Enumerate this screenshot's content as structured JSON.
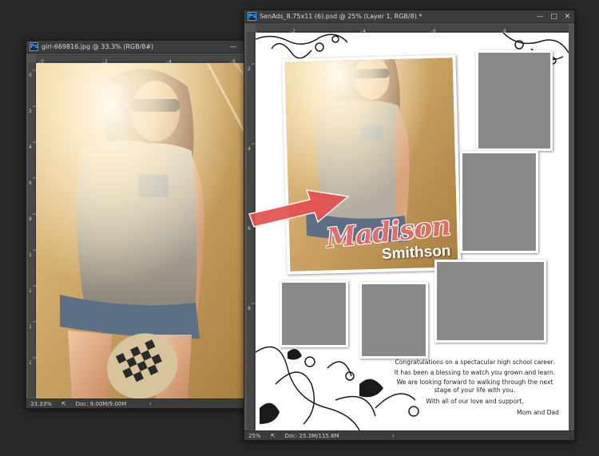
{
  "windows": {
    "photo": {
      "title": "girl-669816.jpg @ 33.3% (RGB/8#)",
      "zoom": "33.33%",
      "doc_info": "Doc: 9.00M/9.00M"
    },
    "layout": {
      "title": "SenAds_8.75x11 (6).psd @ 25% (Layer 1, RGB/8) *",
      "zoom": "25%",
      "doc_info": "Doc: 25.3M/115.8M"
    }
  },
  "app_logo": "Ps",
  "window_buttons": {
    "minimize": "—",
    "maximize": "□",
    "close": "✕"
  },
  "status_arrow": "›",
  "ruler": {
    "photo_h": [
      "0",
      "2",
      "4",
      "6"
    ],
    "photo_v": [
      "0",
      "2",
      "4",
      "6",
      "8",
      "1",
      "1",
      "1",
      "1"
    ],
    "layout_h": [
      "2",
      "4",
      "6",
      "8"
    ],
    "layout_v": [
      "2",
      "4",
      "6",
      "8"
    ]
  },
  "name_text": {
    "first": "Madison",
    "last": "Smithson"
  },
  "message": {
    "lines": [
      "Congratulations on a spectacular high school career.",
      "It has been a blessing to watch you grown and learn.",
      "We are looking forward to walking through the next stage of your life with you.",
      "With all of our love and support,"
    ],
    "signature": "Mom and Dad"
  },
  "colors": {
    "workspace": "#282828",
    "panel": "#535353",
    "arrow": "#e45050",
    "name_accent": "#e06c6c",
    "placeholder": "#898989"
  }
}
